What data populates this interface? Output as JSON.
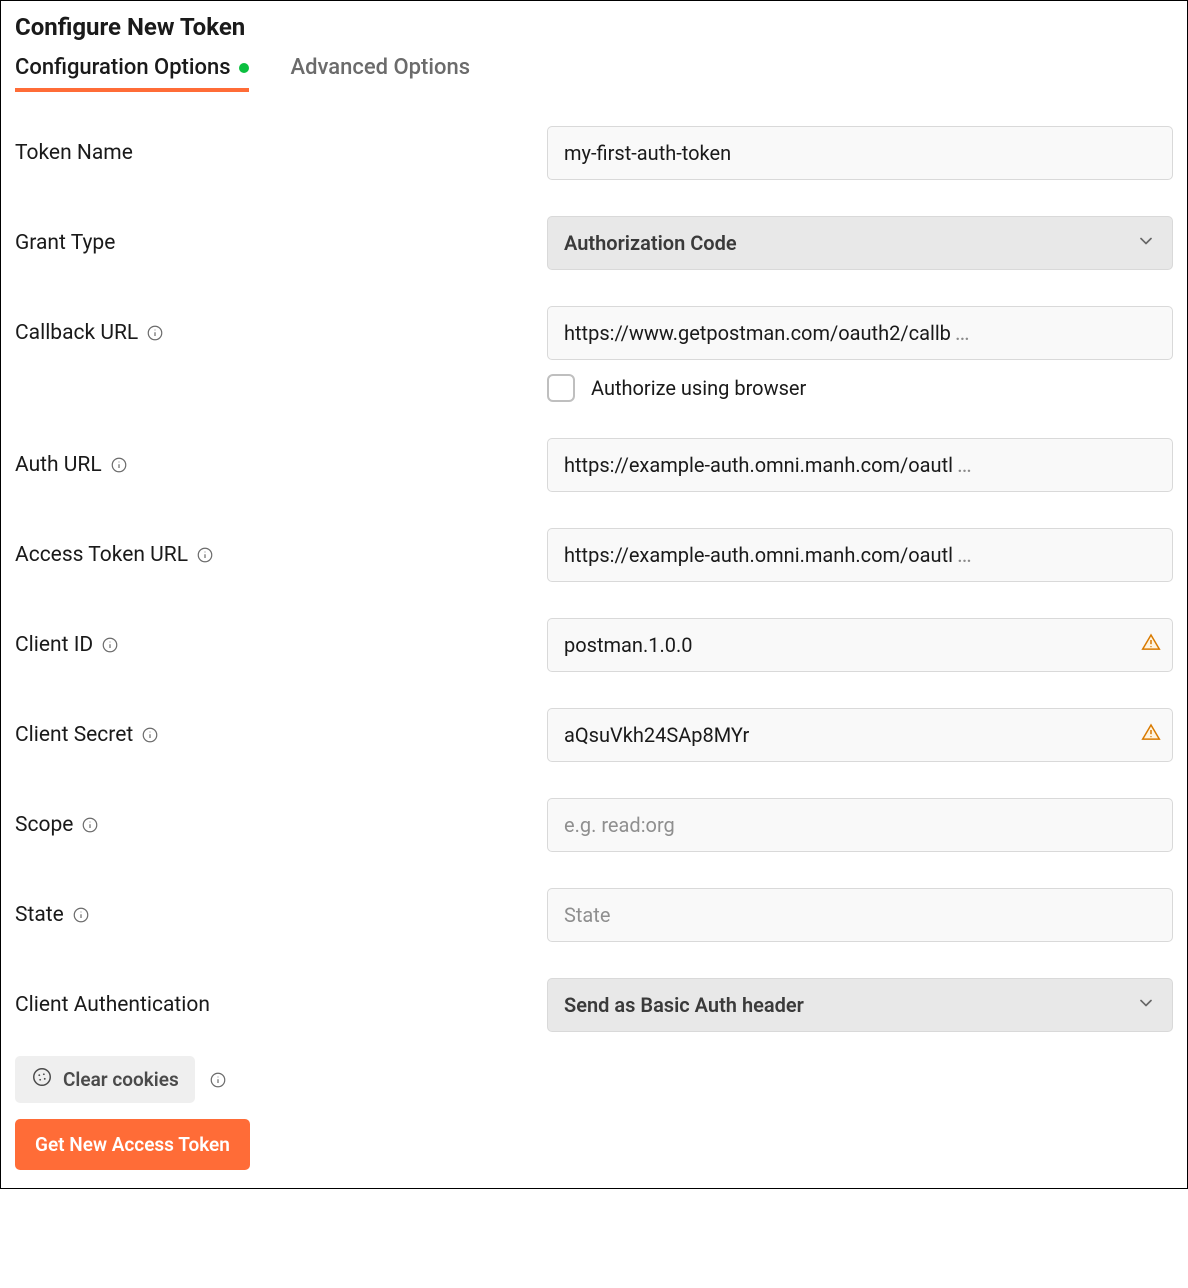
{
  "header": {
    "title": "Configure New Token"
  },
  "tabs": {
    "config": "Configuration Options",
    "advanced": "Advanced Options"
  },
  "labels": {
    "tokenName": "Token Name",
    "grantType": "Grant Type",
    "callbackUrl": "Callback URL",
    "authorizeBrowser": "Authorize using browser",
    "authUrl": "Auth URL",
    "accessTokenUrl": "Access Token URL",
    "clientId": "Client ID",
    "clientSecret": "Client Secret",
    "scope": "Scope",
    "state": "State",
    "clientAuth": "Client Authentication"
  },
  "values": {
    "tokenName": "my-first-auth-token",
    "grantType": "Authorization Code",
    "callbackUrl": "https://www.getpostman.com/oauth2/callb",
    "authUrl": "https://example-auth.omni.manh.com/oautl",
    "accessTokenUrl": "https://example-auth.omni.manh.com/oautl",
    "clientId": "postman.1.0.0",
    "clientSecret": "aQsuVkh24SAp8MYr",
    "scope": "",
    "state": "",
    "clientAuth": "Send as Basic Auth header"
  },
  "placeholders": {
    "scope": "e.g. read:org",
    "state": "State"
  },
  "buttons": {
    "clearCookies": "Clear cookies",
    "getToken": "Get New Access Token"
  },
  "colors": {
    "accent": "#ff6c37",
    "statusDot": "#0bbf3f",
    "warning": "#d97a00"
  }
}
